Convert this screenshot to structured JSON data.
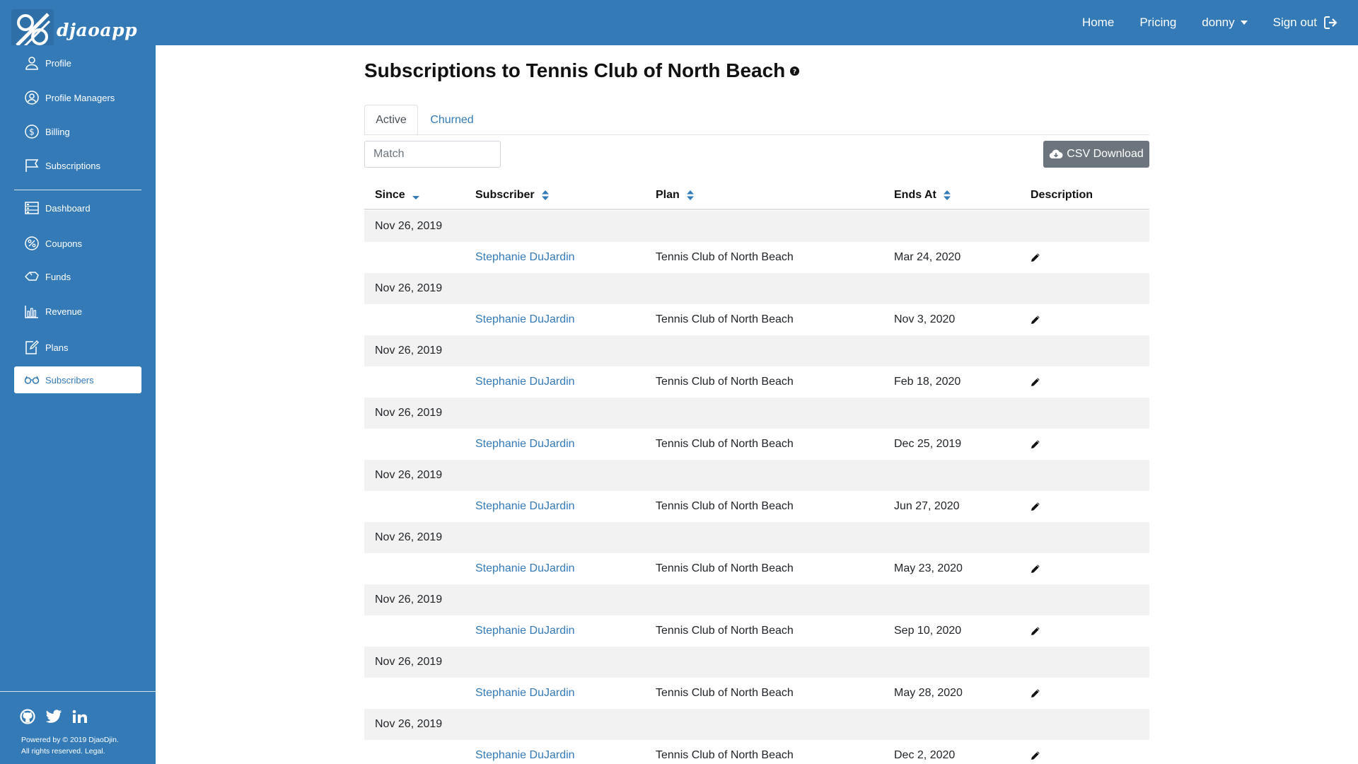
{
  "brand": {
    "name": "djaoapp"
  },
  "nav": {
    "home": "Home",
    "pricing": "Pricing",
    "user": "donny",
    "signout": "Sign out"
  },
  "sidebar": {
    "items": [
      {
        "label": "Profile",
        "icon": "user-icon"
      },
      {
        "label": "Profile Managers",
        "icon": "user-circle-icon"
      },
      {
        "label": "Billing",
        "icon": "dollar-circle-icon"
      },
      {
        "label": "Subscriptions",
        "icon": "flag-icon"
      },
      {
        "label": "Dashboard",
        "icon": "dashboard-icon"
      },
      {
        "label": "Coupons",
        "icon": "percent-icon"
      },
      {
        "label": "Funds",
        "icon": "funds-icon"
      },
      {
        "label": "Revenue",
        "icon": "chart-icon"
      },
      {
        "label": "Plans",
        "icon": "edit-icon"
      },
      {
        "label": "Subscribers",
        "icon": "glasses-icon",
        "active": true
      }
    ],
    "footer": {
      "powered": "Powered by © 2019 DjaoDjin.",
      "rights": "All rights reserved.",
      "legal": "Legal."
    }
  },
  "page": {
    "title": "Subscriptions to Tennis Club of North Beach"
  },
  "tabs": {
    "active": "Active",
    "churned": "Churned"
  },
  "search": {
    "placeholder": "Match"
  },
  "csv": {
    "label": "CSV Download"
  },
  "table": {
    "headers": {
      "since": "Since",
      "subscriber": "Subscriber",
      "plan": "Plan",
      "ends_at": "Ends At",
      "description": "Description"
    },
    "rows": [
      {
        "since": "Nov 26, 2019",
        "subscriber": "Stephanie DuJardin",
        "plan": "Tennis Club of North Beach",
        "ends_at": "Mar 24, 2020"
      },
      {
        "since": "Nov 26, 2019",
        "subscriber": "Stephanie DuJardin",
        "plan": "Tennis Club of North Beach",
        "ends_at": "Nov 3, 2020"
      },
      {
        "since": "Nov 26, 2019",
        "subscriber": "Stephanie DuJardin",
        "plan": "Tennis Club of North Beach",
        "ends_at": "Feb 18, 2020"
      },
      {
        "since": "Nov 26, 2019",
        "subscriber": "Stephanie DuJardin",
        "plan": "Tennis Club of North Beach",
        "ends_at": "Dec 25, 2019"
      },
      {
        "since": "Nov 26, 2019",
        "subscriber": "Stephanie DuJardin",
        "plan": "Tennis Club of North Beach",
        "ends_at": "Jun 27, 2020"
      },
      {
        "since": "Nov 26, 2019",
        "subscriber": "Stephanie DuJardin",
        "plan": "Tennis Club of North Beach",
        "ends_at": "May 23, 2020"
      },
      {
        "since": "Nov 26, 2019",
        "subscriber": "Stephanie DuJardin",
        "plan": "Tennis Club of North Beach",
        "ends_at": "Sep 10, 2020"
      },
      {
        "since": "Nov 26, 2019",
        "subscriber": "Stephanie DuJardin",
        "plan": "Tennis Club of North Beach",
        "ends_at": "May 28, 2020"
      },
      {
        "since": "Nov 26, 2019",
        "subscriber": "Stephanie DuJardin",
        "plan": "Tennis Club of North Beach",
        "ends_at": "Dec 2, 2020"
      }
    ]
  },
  "colors": {
    "primary": "#337ab7",
    "secondary": "#6c757d",
    "stripe": "#f2f2f2"
  }
}
